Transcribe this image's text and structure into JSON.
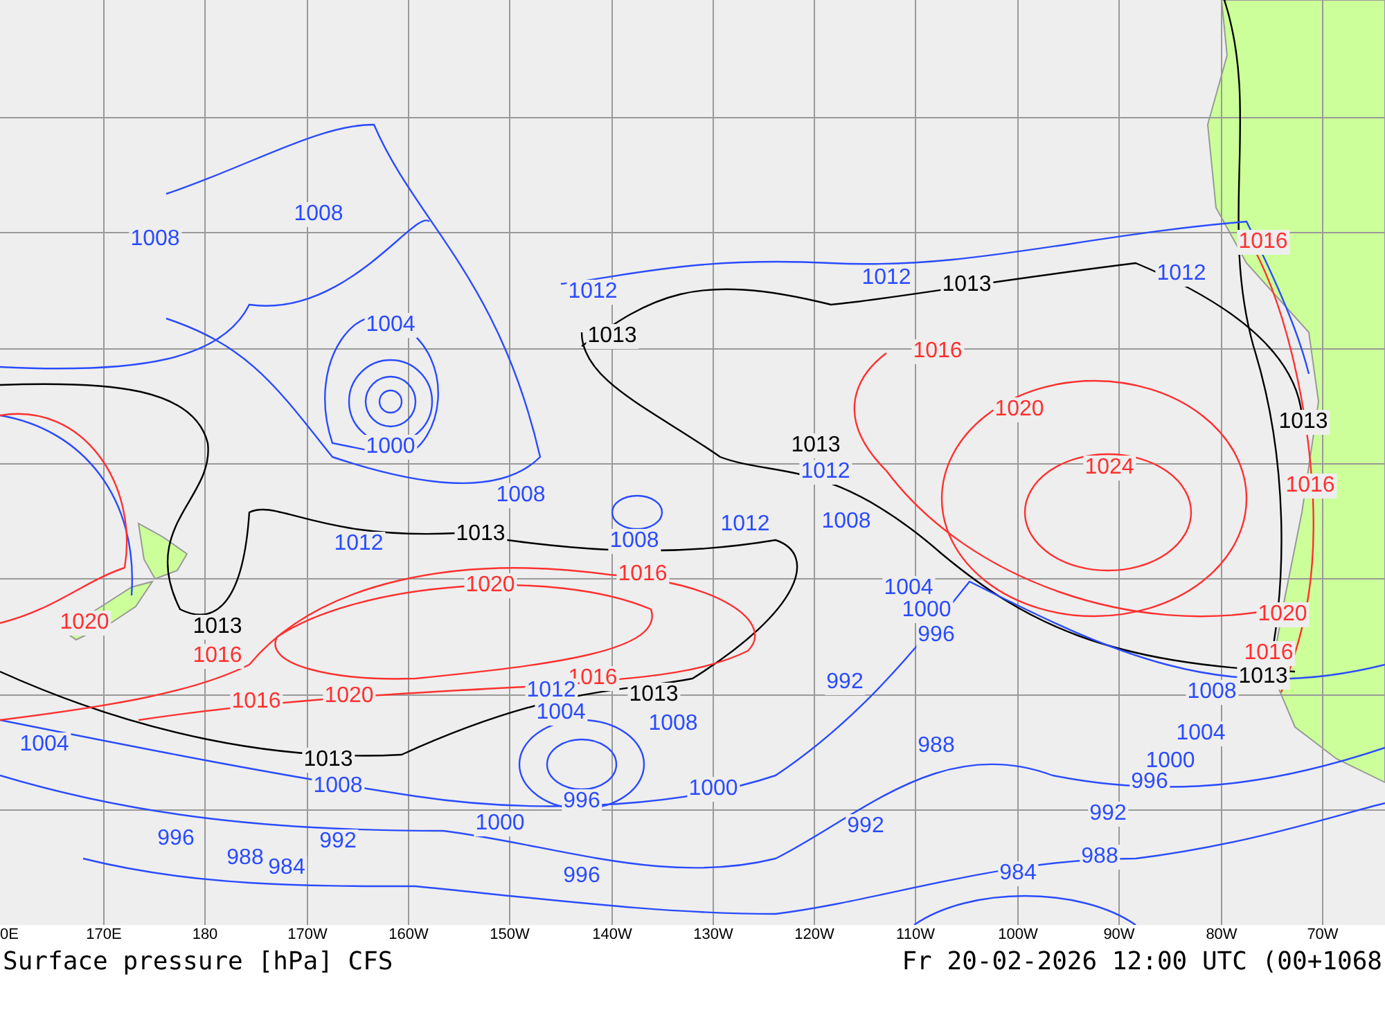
{
  "map": {
    "isobar_labels": [
      {
        "text": "1008",
        "color": "#2a4bff"
      },
      {
        "text": "1008",
        "color": "#2a4bff"
      },
      {
        "text": "1004",
        "color": "#2a4bff"
      },
      {
        "text": "1000",
        "color": "#2a4bff"
      },
      {
        "text": "1012",
        "color": "#2a4bff"
      },
      {
        "text": "1013",
        "color": "#000000"
      },
      {
        "text": "1012",
        "color": "#2a4bff"
      },
      {
        "text": "1013",
        "color": "#000000"
      },
      {
        "text": "1012",
        "color": "#2a4bff"
      },
      {
        "text": "1016",
        "color": "#ff3030"
      },
      {
        "text": "1016",
        "color": "#ff3030"
      },
      {
        "text": "1020",
        "color": "#ff3030"
      },
      {
        "text": "1013",
        "color": "#000000"
      },
      {
        "text": "1024",
        "color": "#ff3030"
      },
      {
        "text": "1012",
        "color": "#2a4bff"
      },
      {
        "text": "1016",
        "color": "#ff3030"
      },
      {
        "text": "1013",
        "color": "#000000"
      },
      {
        "text": "1008",
        "color": "#2a4bff"
      },
      {
        "text": "1008",
        "color": "#2a4bff"
      },
      {
        "text": "1012",
        "color": "#2a4bff"
      },
      {
        "text": "1008",
        "color": "#2a4bff"
      },
      {
        "text": "1012",
        "color": "#2a4bff"
      },
      {
        "text": "1013",
        "color": "#000000"
      },
      {
        "text": "1016",
        "color": "#ff3030"
      },
      {
        "text": "1020",
        "color": "#ff3030"
      },
      {
        "text": "1004",
        "color": "#2a4bff"
      },
      {
        "text": "1000",
        "color": "#2a4bff"
      },
      {
        "text": "996",
        "color": "#2a4bff"
      },
      {
        "text": "1020",
        "color": "#ff3030"
      },
      {
        "text": "1020",
        "color": "#ff3030"
      },
      {
        "text": "1013",
        "color": "#000000"
      },
      {
        "text": "1016",
        "color": "#ff3030"
      },
      {
        "text": "1016",
        "color": "#ff3030"
      },
      {
        "text": "1013",
        "color": "#000000"
      },
      {
        "text": "1008",
        "color": "#2a4bff"
      },
      {
        "text": "1016",
        "color": "#ff3030"
      },
      {
        "text": "1012",
        "color": "#2a4bff"
      },
      {
        "text": "1013",
        "color": "#000000"
      },
      {
        "text": "992",
        "color": "#2a4bff"
      },
      {
        "text": "1016",
        "color": "#ff3030"
      },
      {
        "text": "1020",
        "color": "#ff3030"
      },
      {
        "text": "1004",
        "color": "#2a4bff"
      },
      {
        "text": "1008",
        "color": "#2a4bff"
      },
      {
        "text": "1004",
        "color": "#2a4bff"
      },
      {
        "text": "988",
        "color": "#2a4bff"
      },
      {
        "text": "1004",
        "color": "#2a4bff"
      },
      {
        "text": "1013",
        "color": "#000000"
      },
      {
        "text": "1000",
        "color": "#2a4bff"
      },
      {
        "text": "1008",
        "color": "#2a4bff"
      },
      {
        "text": "996",
        "color": "#2a4bff"
      },
      {
        "text": "1000",
        "color": "#2a4bff"
      },
      {
        "text": "996",
        "color": "#2a4bff"
      },
      {
        "text": "992",
        "color": "#2a4bff"
      },
      {
        "text": "1000",
        "color": "#2a4bff"
      },
      {
        "text": "992",
        "color": "#2a4bff"
      },
      {
        "text": "996",
        "color": "#2a4bff"
      },
      {
        "text": "992",
        "color": "#2a4bff"
      },
      {
        "text": "988",
        "color": "#2a4bff"
      },
      {
        "text": "984",
        "color": "#2a4bff"
      },
      {
        "text": "988",
        "color": "#2a4bff"
      },
      {
        "text": "996",
        "color": "#2a4bff"
      },
      {
        "text": "984",
        "color": "#2a4bff"
      }
    ]
  },
  "x_axis": {
    "labels": [
      "0E",
      "170E",
      "180",
      "170W",
      "160W",
      "150W",
      "140W",
      "130W",
      "120W",
      "110W",
      "100W",
      "90W",
      "80W",
      "70W"
    ]
  },
  "title": "Surface pressure [hPa] CFS",
  "valid_time": "Fr 20-02-2026 12:00 UTC (00+1068"
}
